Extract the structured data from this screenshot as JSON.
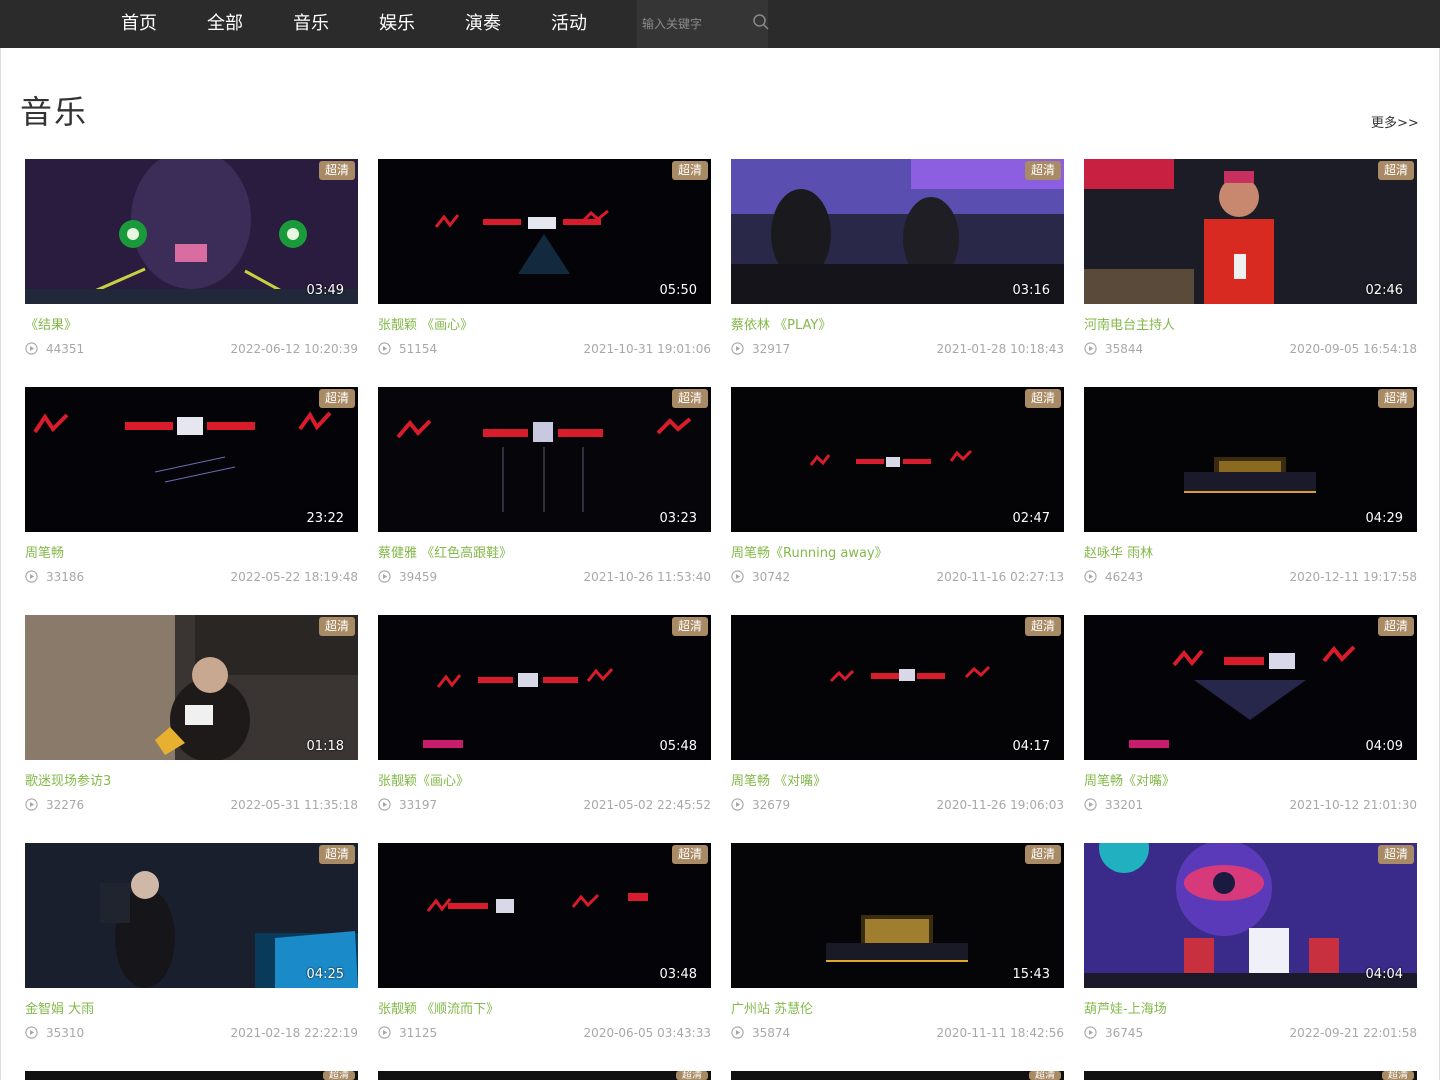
{
  "nav": {
    "items": [
      "首页",
      "全部",
      "音乐",
      "娱乐",
      "演奏",
      "活动"
    ]
  },
  "search": {
    "placeholder": "输入关键字",
    "icon": "search-icon"
  },
  "section": {
    "title": "音乐",
    "more_label": "更多>>"
  },
  "colors": {
    "title_green": "#84b94a",
    "badge": "#a88a64",
    "topbar": "#2b2b2b"
  },
  "videos": [
    {
      "title": "《结果》",
      "views": "44351",
      "date": "2022-06-12 10:20:39",
      "duration": "03:49",
      "quality": "超清"
    },
    {
      "title": "张靓颖 《画心》",
      "views": "51154",
      "date": "2021-10-31 19:01:06",
      "duration": "05:50",
      "quality": "超清"
    },
    {
      "title": "蔡依林 《PLAY》",
      "views": "32917",
      "date": "2021-01-28 10:18:43",
      "duration": "03:16",
      "quality": "超清"
    },
    {
      "title": "河南电台主持人",
      "views": "35844",
      "date": "2020-09-05 16:54:18",
      "duration": "02:46",
      "quality": "超清"
    },
    {
      "title": "周笔畅",
      "views": "33186",
      "date": "2022-05-22 18:19:48",
      "duration": "23:22",
      "quality": "超清"
    },
    {
      "title": "蔡健雅 《红色高跟鞋》",
      "views": "39459",
      "date": "2021-10-26 11:53:40",
      "duration": "03:23",
      "quality": "超清"
    },
    {
      "title": "周笔畅《Running away》",
      "views": "30742",
      "date": "2020-11-16 02:27:13",
      "duration": "02:47",
      "quality": "超清"
    },
    {
      "title": "赵咏华 雨林",
      "views": "46243",
      "date": "2020-12-11 19:17:58",
      "duration": "04:29",
      "quality": "超清"
    },
    {
      "title": "歌迷现场参访3",
      "views": "32276",
      "date": "2022-05-31 11:35:18",
      "duration": "01:18",
      "quality": "超清"
    },
    {
      "title": "张靓颖《画心》",
      "views": "33197",
      "date": "2021-05-02 22:45:52",
      "duration": "05:48",
      "quality": "超清"
    },
    {
      "title": "周笔畅 《对嘴》",
      "views": "32679",
      "date": "2020-11-26 19:06:03",
      "duration": "04:17",
      "quality": "超清"
    },
    {
      "title": "周笔畅《对嘴》",
      "views": "33201",
      "date": "2021-10-12 21:01:30",
      "duration": "04:09",
      "quality": "超清"
    },
    {
      "title": "金智娟 大雨",
      "views": "35310",
      "date": "2021-02-18 22:22:19",
      "duration": "04:25",
      "quality": "超清"
    },
    {
      "title": "张靓颖 《顺流而下》",
      "views": "31125",
      "date": "2020-06-05 03:43:33",
      "duration": "03:48",
      "quality": "超清"
    },
    {
      "title": "广州站 苏慧伦",
      "views": "35874",
      "date": "2020-11-11 18:42:56",
      "duration": "15:43",
      "quality": "超清"
    },
    {
      "title": "葫芦娃-上海场",
      "views": "36745",
      "date": "2022-09-21 22:01:58",
      "duration": "04:04",
      "quality": "超清"
    }
  ],
  "partial_row_badges": [
    "超清",
    "超清",
    "超清",
    "超清"
  ]
}
